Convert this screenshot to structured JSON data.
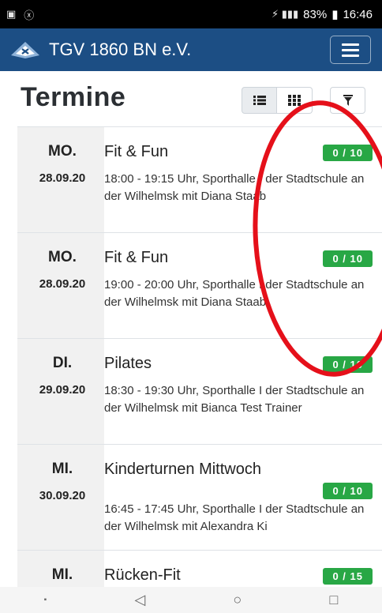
{
  "statusbar": {
    "left_icons": [
      "▣",
      "ⓧ"
    ],
    "signal": "⚡ ▮▮▮",
    "battery": "83%",
    "time": "16:46"
  },
  "appbar": {
    "title": "TGV 1860 BN e.V."
  },
  "page": {
    "heading": "Termine"
  },
  "view_toggle": {
    "list_icon": "list-icon",
    "grid_icon": "grid-icon",
    "filter_icon": "filter-icon"
  },
  "events": [
    {
      "dow": "MO.",
      "date": "28.09.20",
      "title": "Fit & Fun",
      "badge": "0 / 10",
      "details": "18:00 - 19:15 Uhr, Sporthalle I der Stadtschule an der Wilhelmsk mit Diana Staab"
    },
    {
      "dow": "MO.",
      "date": "28.09.20",
      "title": "Fit & Fun",
      "badge": "0 / 10",
      "details": "19:00 - 20:00 Uhr, Sporthalle I der Stadtschule an der Wilhelmsk mit Diana Staab"
    },
    {
      "dow": "DI.",
      "date": "29.09.20",
      "title": "Pilates",
      "badge": "0 / 10",
      "details": "18:30 - 19:30 Uhr, Sporthalle I der Stadtschule an der Wilhelmsk mit Bianca Test Trainer"
    },
    {
      "dow": "MI.",
      "date": "30.09.20",
      "title": "Kinderturnen Mittwoch",
      "badge": "0 / 10",
      "details": "16:45 - 17:45 Uhr, Sporthalle I der Stadtschule an der Wilhelmsk mit Alexandra Ki"
    },
    {
      "dow": "MI.",
      "date": "",
      "title": "Rücken-Fit",
      "badge": "0 / 15",
      "details": ""
    }
  ],
  "navbar": {
    "items": [
      "▪",
      "◁",
      "○",
      "□"
    ]
  },
  "colors": {
    "brand": "#1c4e84",
    "badge": "#28a745",
    "annotation": "#e5101a"
  }
}
